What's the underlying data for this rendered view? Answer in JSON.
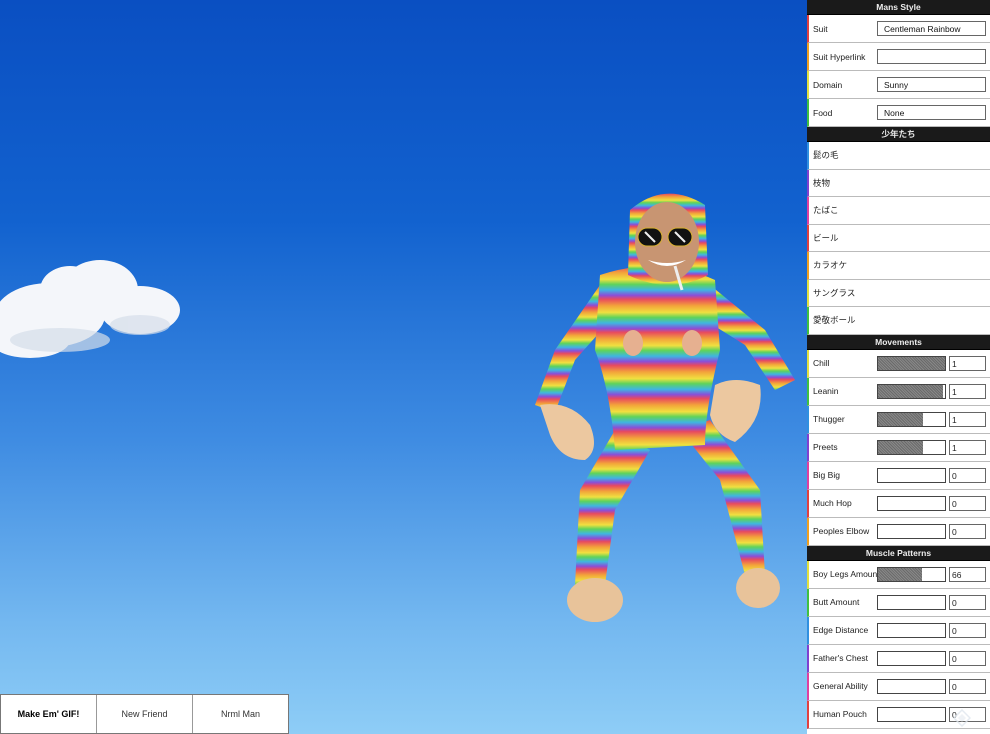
{
  "toolbar": {
    "gif_label": "Make Em' GIF!",
    "friend_label": "New Friend",
    "normal_label": "Nrml Man"
  },
  "panel": {
    "style_title": "Mans Style",
    "style_rows": [
      {
        "label": "Suit",
        "value": "Centleman Rainbow"
      },
      {
        "label": "Suit Hyperlink",
        "value": ""
      },
      {
        "label": "Domain",
        "value": "Sunny"
      },
      {
        "label": "Food",
        "value": "None"
      }
    ],
    "boys_title": "少年たち",
    "boys_items": [
      "髭の毛",
      "枝物",
      "たばこ",
      "ビール",
      "カラオケ",
      "サングラス",
      "愛敬ボール"
    ],
    "movements_title": "Movements",
    "movements": [
      {
        "label": "Chill",
        "level": 1.0,
        "value": "1"
      },
      {
        "label": "Leanin",
        "level": 0.97,
        "value": "1"
      },
      {
        "label": "Thugger",
        "level": 0.67,
        "value": "1"
      },
      {
        "label": "Preets",
        "level": 0.67,
        "value": "1"
      },
      {
        "label": "Big Big",
        "level": 0,
        "value": "0"
      },
      {
        "label": "Much Hop",
        "level": 0,
        "value": "0"
      },
      {
        "label": "Peoples Elbow",
        "level": 0,
        "value": "0"
      }
    ],
    "muscle_title": "Muscle Patterns",
    "muscles": [
      {
        "label": "Boy Legs Amount",
        "level": 0.66,
        "value": "66"
      },
      {
        "label": "Butt Amount",
        "level": 0,
        "value": "0"
      },
      {
        "label": "Edge Distance",
        "level": 0,
        "value": "0"
      },
      {
        "label": "Father's Chest",
        "level": 0,
        "value": "0"
      },
      {
        "label": "General Ability",
        "level": 0,
        "value": "0"
      },
      {
        "label": "Human Pouch",
        "level": 0,
        "value": "0"
      }
    ]
  },
  "colors": {
    "sky_top": "#0a4fc2",
    "sky_bottom": "#8ecdf6",
    "panel_header": "#1a1a1a",
    "row_accents": [
      "#e04040",
      "#f0a020",
      "#e0e040",
      "#40c040",
      "#3090e0",
      "#8040d0",
      "#e040a0"
    ]
  },
  "icons": {
    "cloud": "cloud-image",
    "figure": "rainbow-man-figure",
    "watermark": "diamond-logo-icon"
  }
}
